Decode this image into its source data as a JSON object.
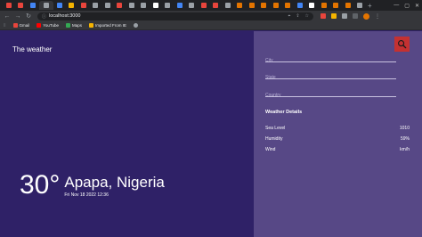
{
  "browser": {
    "url": "localhost:3000",
    "tab_colors": [
      "#e8453c",
      "#e8453c",
      "#4285f4",
      "#9aa0a6",
      "#4285f4",
      "#f5b400",
      "#e8453c",
      "#9aa0a6",
      "#9aa0a6",
      "#e8453c",
      "#9aa0a6",
      "#9aa0a6",
      "#ffffff",
      "#9aa0a6",
      "#4285f4",
      "#9aa0a6",
      "#e8453c",
      "#e8453c",
      "#9aa0a6",
      "#e37400",
      "#e37400",
      "#e37400",
      "#e37400",
      "#e37400",
      "#4285f4",
      "#ffffff",
      "#e37400",
      "#e37400",
      "#e37400",
      "#9aa0a6"
    ],
    "bookmarks": [
      {
        "label": "Gmail",
        "icon": "gmail-icon",
        "color": "#e8453c"
      },
      {
        "label": "YouTube",
        "icon": "youtube-icon",
        "color": "#ff0000"
      },
      {
        "label": "Maps",
        "icon": "maps-icon",
        "color": "#34a853"
      },
      {
        "label": "Imported From IE",
        "icon": "folder-icon",
        "color": "#f5b400"
      },
      {
        "label": "",
        "icon": "globe-icon",
        "color": "#9aa0a6"
      }
    ]
  },
  "app": {
    "brand": "The weather",
    "temperature": "30°",
    "city": "Apapa, Nigeria",
    "datetime": "Fri Nov 18 2022 12:36",
    "search_placeholders": {
      "city": "City",
      "state": "State",
      "country": "Country"
    },
    "details_title": "Weather Details",
    "details": [
      {
        "label": "Sea Level",
        "value": "1010"
      },
      {
        "label": "Humidity",
        "value": "59%"
      },
      {
        "label": "Wind",
        "value": "km/h"
      }
    ],
    "colors": {
      "main_bg": "#2f2167",
      "side_bg": "#574886",
      "search_button": "#c43131"
    }
  }
}
